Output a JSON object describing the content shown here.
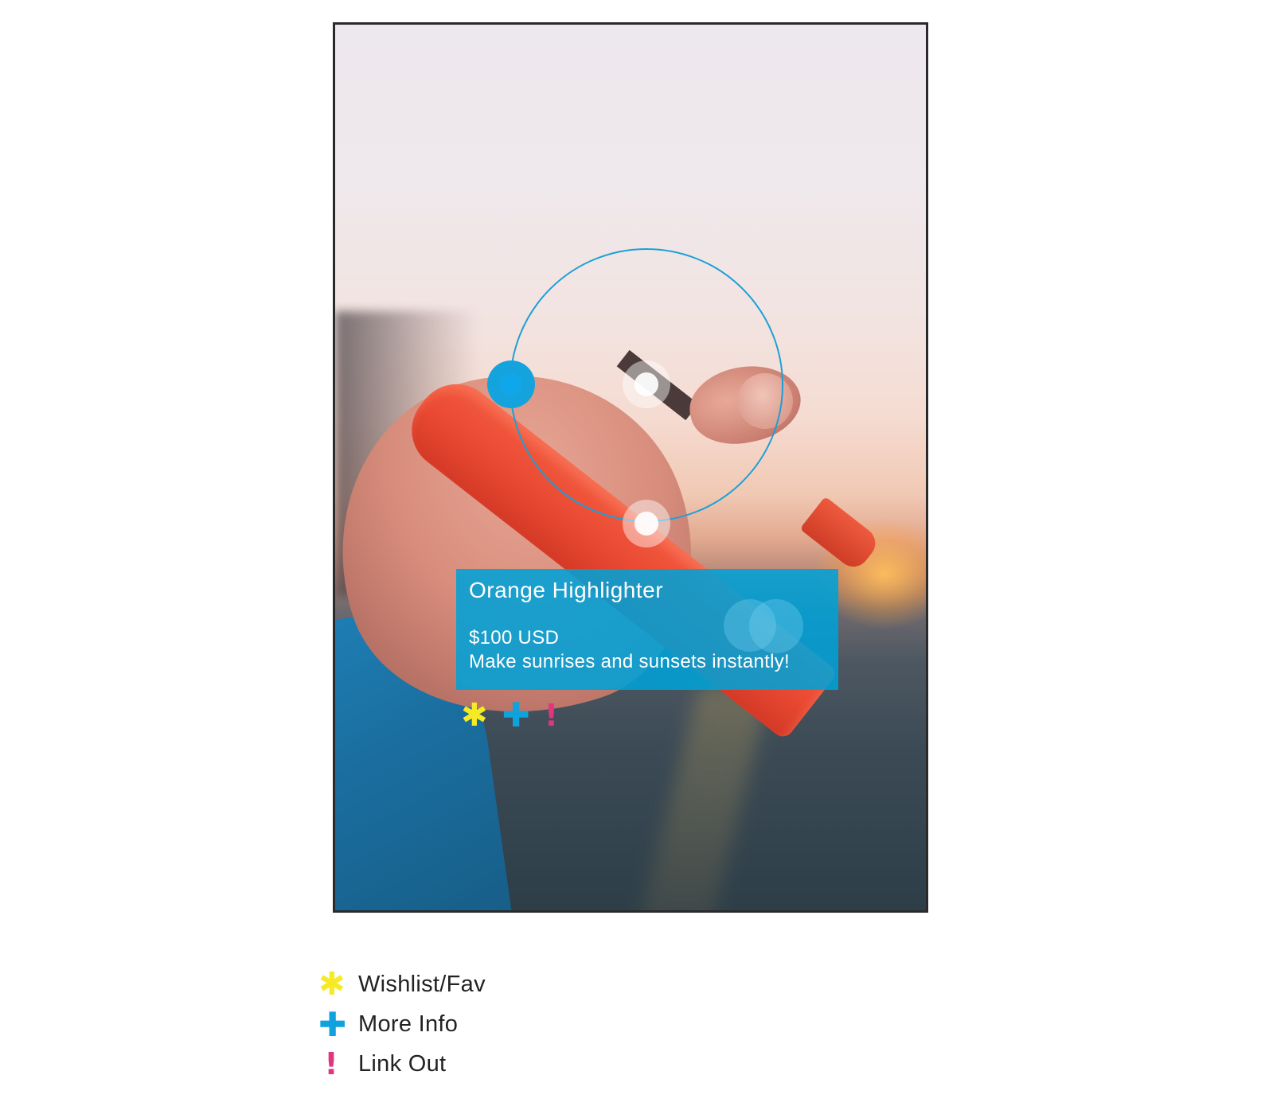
{
  "product_card": {
    "title": "Orange Highlighter",
    "price": "$100 USD",
    "description": "Make sunrises and sunsets instantly!"
  },
  "actions": {
    "wishlist_icon": "✱",
    "more_info_icon": "✚",
    "link_out_icon": "!"
  },
  "legend": [
    {
      "icon": "✱",
      "icon_name": "asterisk-icon",
      "label": "Wishlist/Fav",
      "color": "#f6ea25"
    },
    {
      "icon": "✚",
      "icon_name": "plus-icon",
      "label": "More Info",
      "color": "#0fa2dd"
    },
    {
      "icon": "!",
      "icon_name": "exclamation-icon",
      "label": "Link Out",
      "color": "#e0357f"
    }
  ],
  "colors": {
    "accent_blue": "#0fa2dd",
    "fav_yellow": "#f6ea25",
    "link_magenta": "#e0357f",
    "card_bg": "#00a1d6"
  }
}
